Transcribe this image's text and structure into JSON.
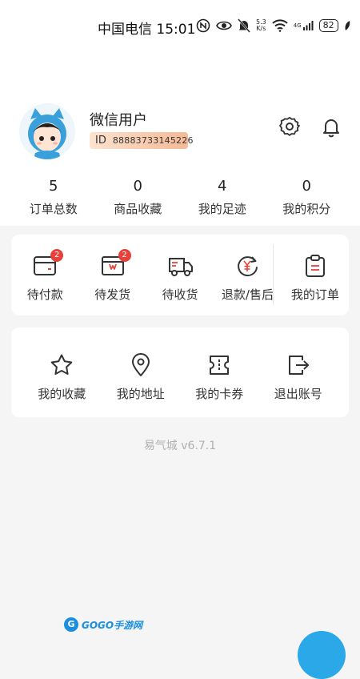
{
  "status_bar": {
    "carrier_time": "中国电信 15:01",
    "speed_top": "5.3",
    "speed_bottom": "K/s",
    "network": "4G",
    "battery": "82"
  },
  "profile": {
    "username": "微信用户",
    "id_label": "ID",
    "id_value": "88883733145226"
  },
  "stats": [
    {
      "value": "5",
      "label": "订单总数"
    },
    {
      "value": "0",
      "label": "商品收藏"
    },
    {
      "value": "4",
      "label": "我的足迹"
    },
    {
      "value": "0",
      "label": "我的积分"
    }
  ],
  "orders": [
    {
      "label": "待付款",
      "badge": "2",
      "icon": "wallet-icon"
    },
    {
      "label": "待发货",
      "badge": "2",
      "icon": "package-icon"
    },
    {
      "label": "待收货",
      "badge": "",
      "icon": "truck-icon"
    },
    {
      "label": "退款/售后",
      "badge": "",
      "icon": "refund-yen-icon"
    },
    {
      "label": "我的订单",
      "badge": "",
      "icon": "clipboard-icon"
    }
  ],
  "tools": [
    {
      "label": "我的收藏",
      "icon": "star-icon"
    },
    {
      "label": "我的地址",
      "icon": "location-pin-icon"
    },
    {
      "label": "我的卡券",
      "icon": "ticket-icon"
    },
    {
      "label": "退出账号",
      "icon": "logout-icon"
    }
  ],
  "version": "易气城 v6.7.1",
  "watermark": {
    "logo": "G",
    "text": "GOGO手游网"
  },
  "colors": {
    "accent_red": "#e8413a",
    "badge_bg": "#f5b996",
    "watermark_blue": "#1a8fe0"
  }
}
